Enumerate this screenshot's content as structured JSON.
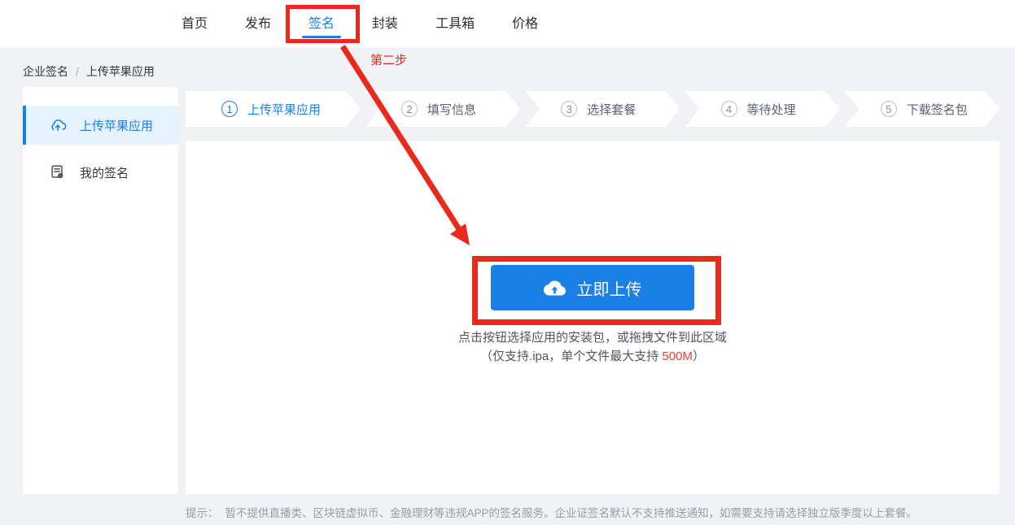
{
  "colors": {
    "accent": "#1a80e5",
    "annotation": "#e8291c",
    "highlight": "#f03b30",
    "selected_bg": "#e6f2fc",
    "page_bg": "#f0f2f5"
  },
  "header": {
    "nav": [
      {
        "label": "首页",
        "active": false
      },
      {
        "label": "发布",
        "active": false
      },
      {
        "label": "签名",
        "active": true
      },
      {
        "label": "封装",
        "active": false
      },
      {
        "label": "工具箱",
        "active": false
      },
      {
        "label": "价格",
        "active": false
      }
    ]
  },
  "annotation": {
    "step_label": "第二步"
  },
  "breadcrumb": {
    "items": [
      "企业签名",
      "上传苹果应用"
    ],
    "separator": "/"
  },
  "sidebar": {
    "items": [
      {
        "label": "上传苹果应用",
        "icon": "upload-cloud-icon",
        "active": true
      },
      {
        "label": "我的签名",
        "icon": "signature-doc-icon",
        "active": false
      }
    ]
  },
  "steps": [
    {
      "num": "1",
      "label": "上传苹果应用",
      "active": true
    },
    {
      "num": "2",
      "label": "填写信息",
      "active": false
    },
    {
      "num": "3",
      "label": "选择套餐",
      "active": false
    },
    {
      "num": "4",
      "label": "等待处理",
      "active": false
    },
    {
      "num": "5",
      "label": "下载签名包",
      "active": false
    }
  ],
  "upload": {
    "button_label": "立即上传",
    "hint_line1": "点击按钮选择应用的安装包，或拖拽文件到此区域",
    "hint_line2_prefix": "（仅支持.ipa，单个文件最大支持 ",
    "hint_line2_highlight": "500M",
    "hint_line2_suffix": "）"
  },
  "footer": {
    "prefix": "提示：",
    "text": "暂不提供直播类、区块链虚拟币、金融理财等违规APP的签名服务。企业证签名默认不支持推送通知，如需要支持请选择独立版季度以上套餐。"
  }
}
